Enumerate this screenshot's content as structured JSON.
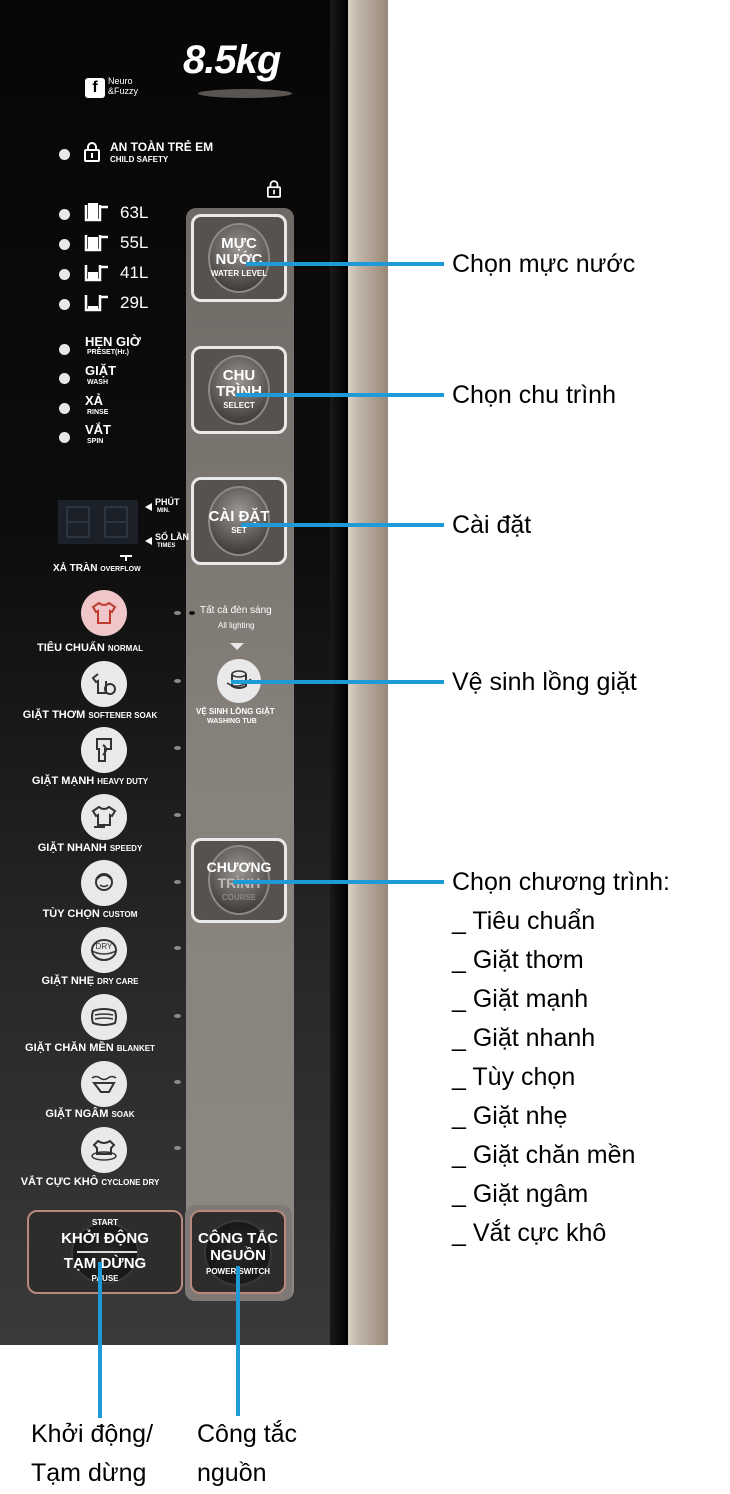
{
  "panel": {
    "capacity": "8.5kg",
    "brand_badge": {
      "letter": "f",
      "line1": "Neuro",
      "line2": "&Fuzzy"
    },
    "child_safety": {
      "vi": "AN TOÀN TRẺ EM",
      "en": "CHILD SAFETY"
    },
    "water_levels": [
      "63L",
      "55L",
      "41L",
      "29L"
    ],
    "status_indicators": [
      {
        "vi": "HẸN GIỜ",
        "en": "PRESET(Hr.)"
      },
      {
        "vi": "GIẶT",
        "en": "WASH"
      },
      {
        "vi": "XẢ",
        "en": "RINSE"
      },
      {
        "vi": "VẮT",
        "en": "SPIN"
      }
    ],
    "display": {
      "minutes": {
        "vi": "PHÚT",
        "en": "MIN."
      },
      "times": {
        "vi": "SỐ LẦN",
        "en": "TIMES"
      },
      "overflow": {
        "vi": "XẢ TRÀN",
        "en": "OVERFLOW"
      }
    },
    "programs": [
      {
        "vi": "TIÊU CHUẨN",
        "en": "NORMAL",
        "icon": "shirt-icon"
      },
      {
        "vi": "GIẶT THƠM",
        "en": "SOFTENER SOAK",
        "icon": "scented-shirt-icon"
      },
      {
        "vi": "GIẶT MẠNH",
        "en": "HEAVY DUTY",
        "icon": "jeans-icon"
      },
      {
        "vi": "GIẶT NHANH",
        "en": "SPEEDY",
        "icon": "quick-shirt-icon"
      },
      {
        "vi": "TÙY CHỌN",
        "en": "CUSTOM",
        "icon": "person-icon"
      },
      {
        "vi": "GIẶT NHẸ",
        "en": "DRY CARE",
        "icon": "dry-icon"
      },
      {
        "vi": "GIẶT CHĂN MỀN",
        "en": "BLANKET",
        "icon": "blanket-icon"
      },
      {
        "vi": "GIẶT NGÂM",
        "en": "SOAK",
        "icon": "soak-icon"
      },
      {
        "vi": "VẮT CỰC KHÔ",
        "en": "CYCLONE DRY",
        "icon": "cyclone-icon"
      }
    ],
    "buttons": {
      "water_level": {
        "line1": "MỰC",
        "line2": "NƯỚC",
        "en": "WATER LEVEL"
      },
      "select": {
        "line1": "CHU",
        "line2": "TRÌNH",
        "en": "SELECT"
      },
      "set": {
        "line1": "CÀI ĐẶT",
        "en": "SET"
      },
      "all_lighting": {
        "vi": "Tất cả đèn sáng",
        "en": "All lighting"
      },
      "tub_clean": {
        "vi": "VỆ SINH LỒNG GIẶT",
        "en": "WASHING TUB"
      },
      "course": {
        "line1": "CHƯƠNG",
        "line2": "TRÌNH",
        "en": "COURSE"
      },
      "start": {
        "en_top": "START",
        "line1": "KHỞI ĐỘNG",
        "line2": "TẠM DỪNG",
        "en": "PAUSE"
      },
      "power": {
        "line1": "CÔNG TẮC",
        "line2": "NGUỒN",
        "en": "POWER SWITCH"
      }
    }
  },
  "callouts": {
    "water_level": "Chọn mực nước",
    "select": "Chọn chu trình",
    "set": "Cài đặt",
    "tub_clean": "Vệ sinh lồng giặt",
    "course_title": "Chọn chương trình:",
    "course_items": [
      "_ Tiêu chuẩn",
      "_ Giặt thơm",
      "_ Giặt mạnh",
      "_ Giặt nhanh",
      "_ Tùy chọn",
      "_ Giặt nhẹ",
      "_ Giặt chăn mền",
      "_ Giặt ngâm",
      "_ Vắt cực khô"
    ],
    "start_line1": "Khởi động/",
    "start_line2": "Tạm dừng",
    "power_line1": "Công tắc",
    "power_line2": "nguồn"
  },
  "colors": {
    "leader_line": "#1e9ad6",
    "panel_black": "#0b0b0b",
    "button_strip": "#7d7771"
  }
}
